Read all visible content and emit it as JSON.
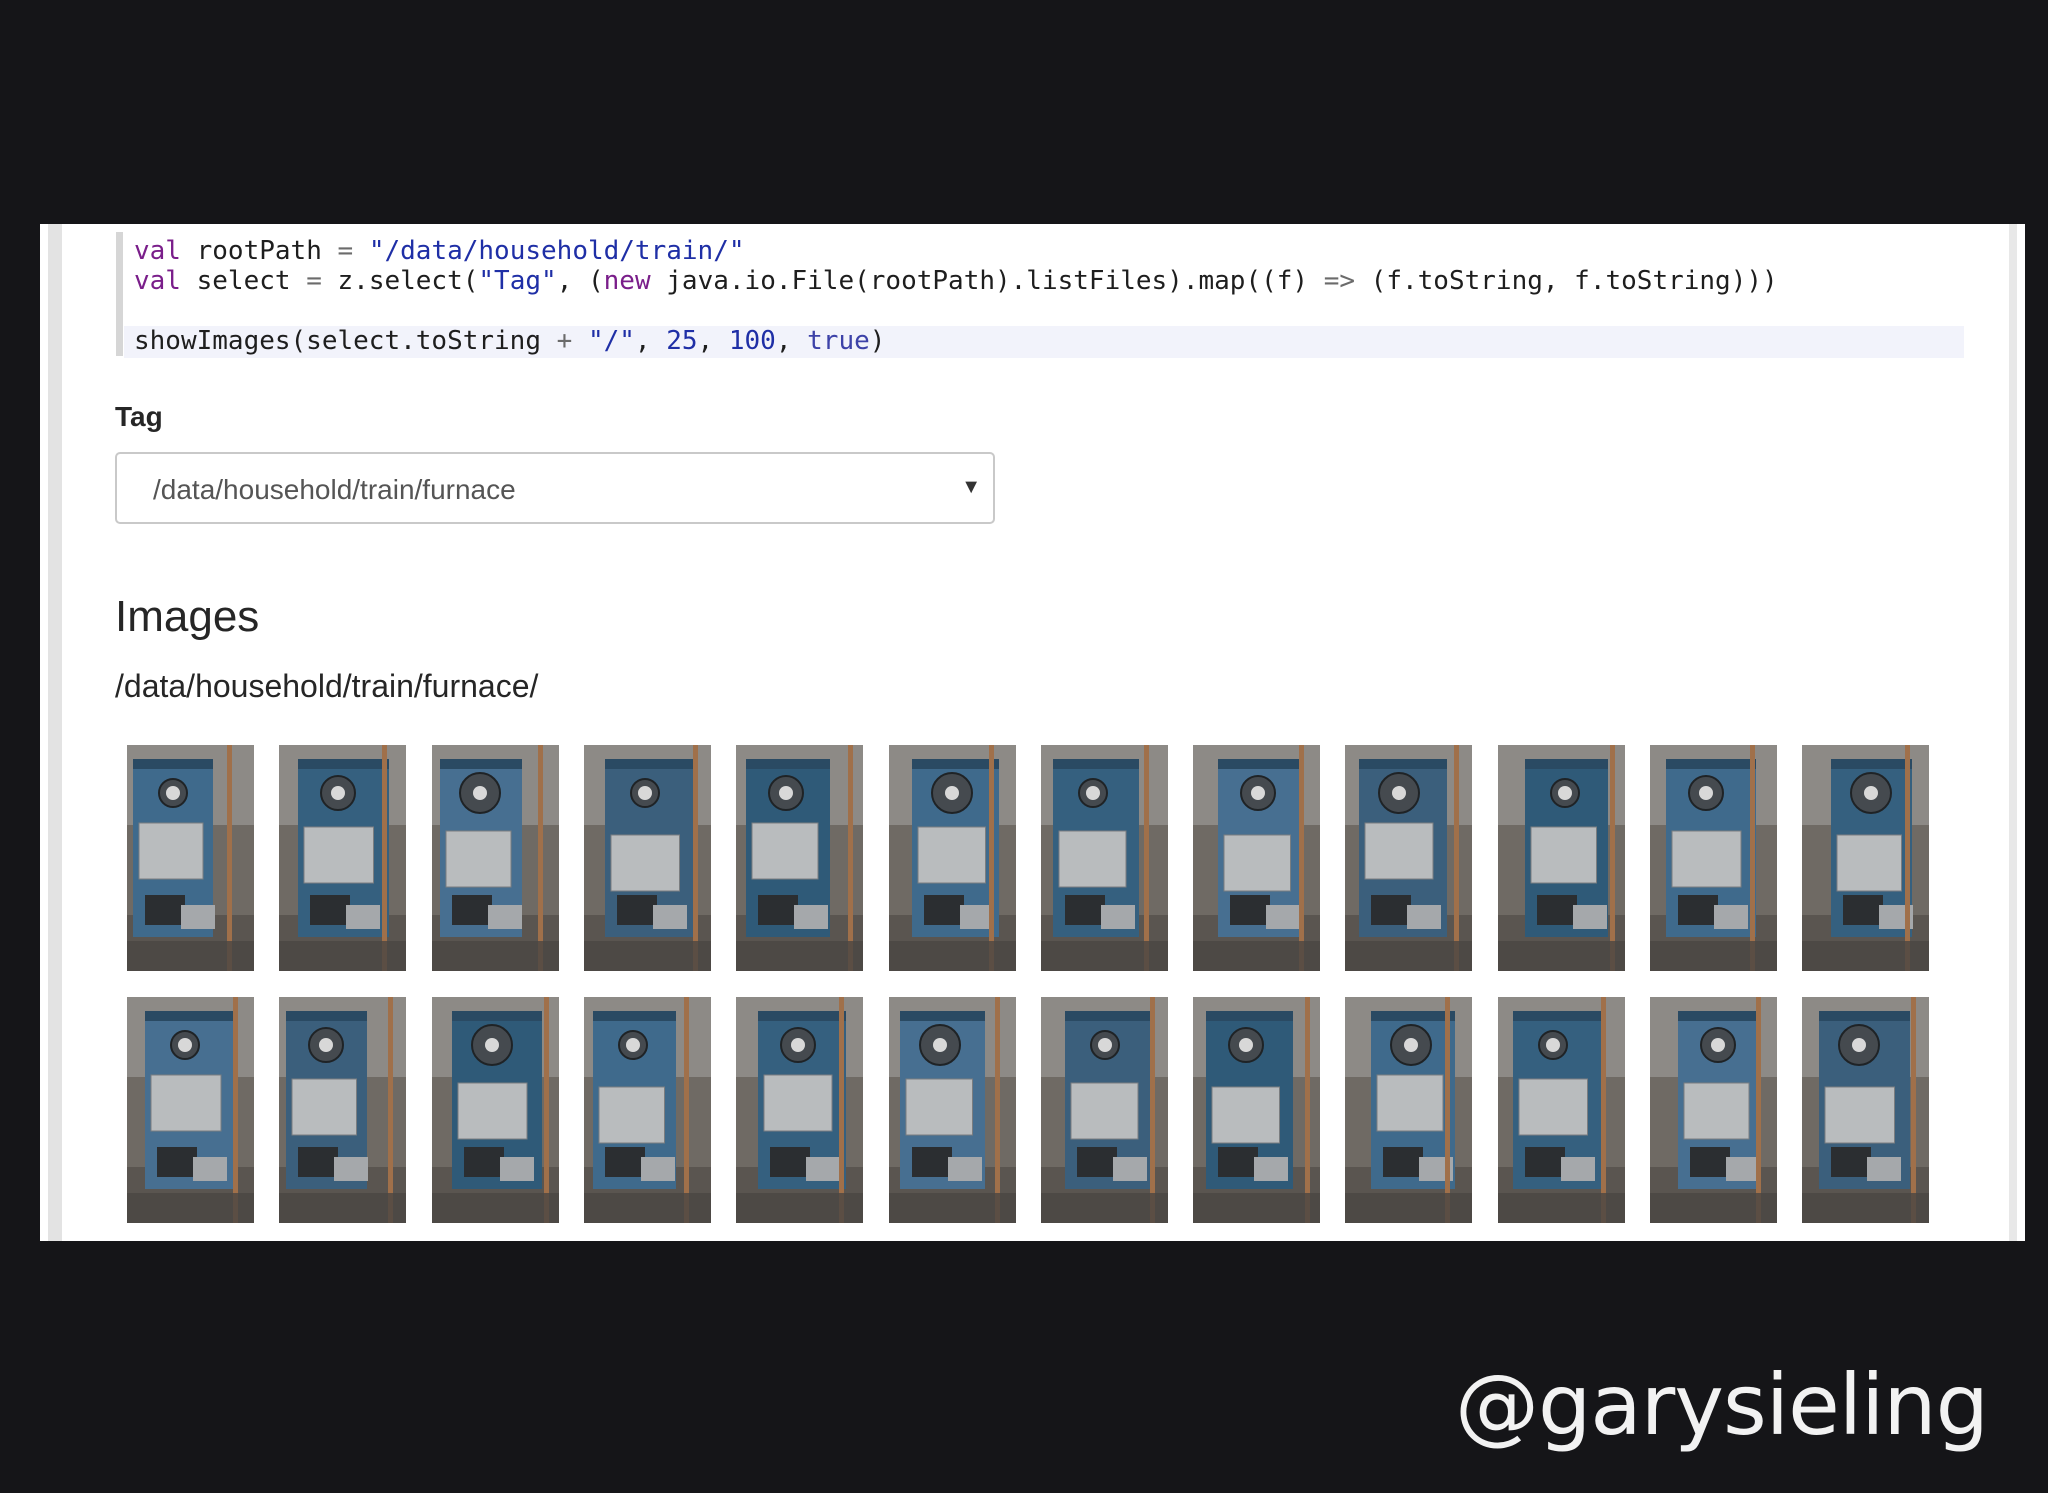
{
  "code": {
    "line1": {
      "kw": "val",
      "name": " rootPath ",
      "op": "=",
      "str": " \"/data/household/train/\""
    },
    "line2": {
      "kw": "val",
      "rest1": " select ",
      "op": "=",
      "rest2": " z.select(",
      "str": "\"Tag\"",
      "rest3": ", (",
      "kw2": "new",
      "rest4": " java.io.File(rootPath).listFiles).map((f) ",
      "arrow": "=>",
      "rest5": " (f.toString, f.toString)))"
    },
    "line3": {
      "fn": "showImages(select.toString ",
      "op": "+",
      "str": " \"/\"",
      "sep1": ", ",
      "n1": "25",
      "sep2": ", ",
      "n2": "100",
      "sep3": ", ",
      "bool": "true",
      "close": ")"
    }
  },
  "form": {
    "tag_label": "Tag",
    "selected_value": "/data/household/train/furnace",
    "arrow": "▼"
  },
  "results": {
    "title": "Images",
    "path": "/data/household/train/furnace/"
  },
  "gallery": {
    "rows": 2,
    "columns": 12,
    "subject": "furnace photo thumbnails"
  },
  "colors": {
    "slide_bg": "#151518",
    "panel_bg": "#ffffff",
    "keyword": "#7a1e8a",
    "string": "#1f2fa6",
    "furnace_blue": "#3f6a8c"
  },
  "footer": {
    "handle": "@garysieling"
  }
}
